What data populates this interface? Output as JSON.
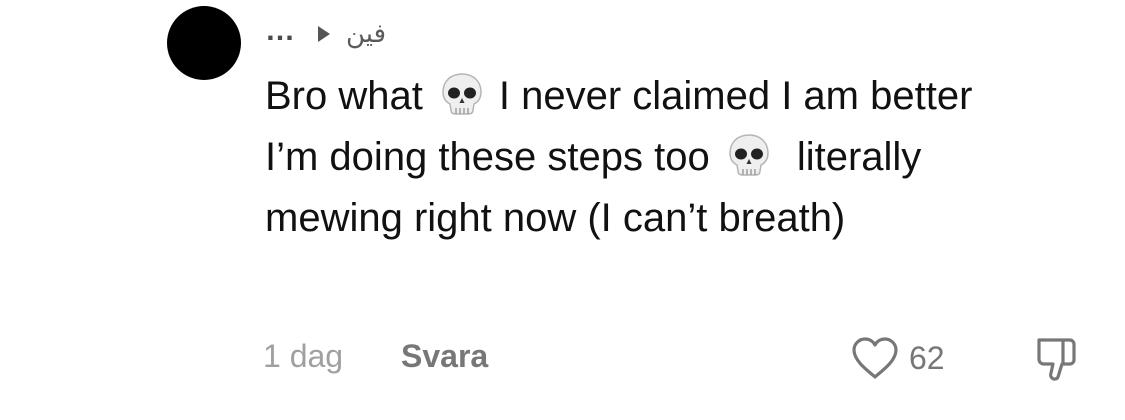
{
  "comment": {
    "author_arrow_icon": "play-right-icon",
    "menu_ellipsis": "…",
    "reply_to_name": "فين",
    "text_parts": [
      "Bro what",
      "I never claimed I am better I’m doing these steps too",
      "literally mewing right now (I can’t breath)"
    ],
    "emoji": "skull-emoji",
    "time": "1 dag",
    "reply_label": "Svara",
    "like_count": "62",
    "icons": [
      "heart-icon",
      "dislike-icon"
    ]
  }
}
